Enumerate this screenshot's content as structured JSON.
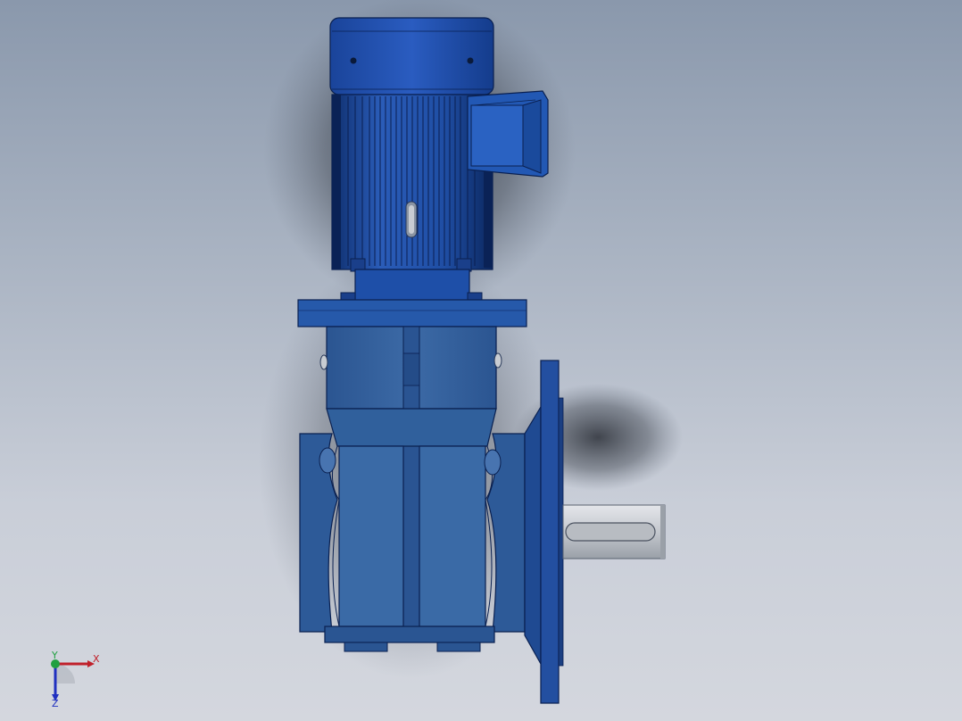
{
  "viewport": {
    "background_top": "#8a98ac",
    "background_bottom": "#d4d7de"
  },
  "model": {
    "body_color": "#2f5f9e",
    "body_dark": "#1a3f7a",
    "shaft_color": "#c8ccd2"
  },
  "triad": {
    "x_label": "X",
    "y_label": "Y",
    "z_label": "Z",
    "x_color": "#c0202a",
    "y_color": "#20a040",
    "z_color": "#2030c0"
  }
}
